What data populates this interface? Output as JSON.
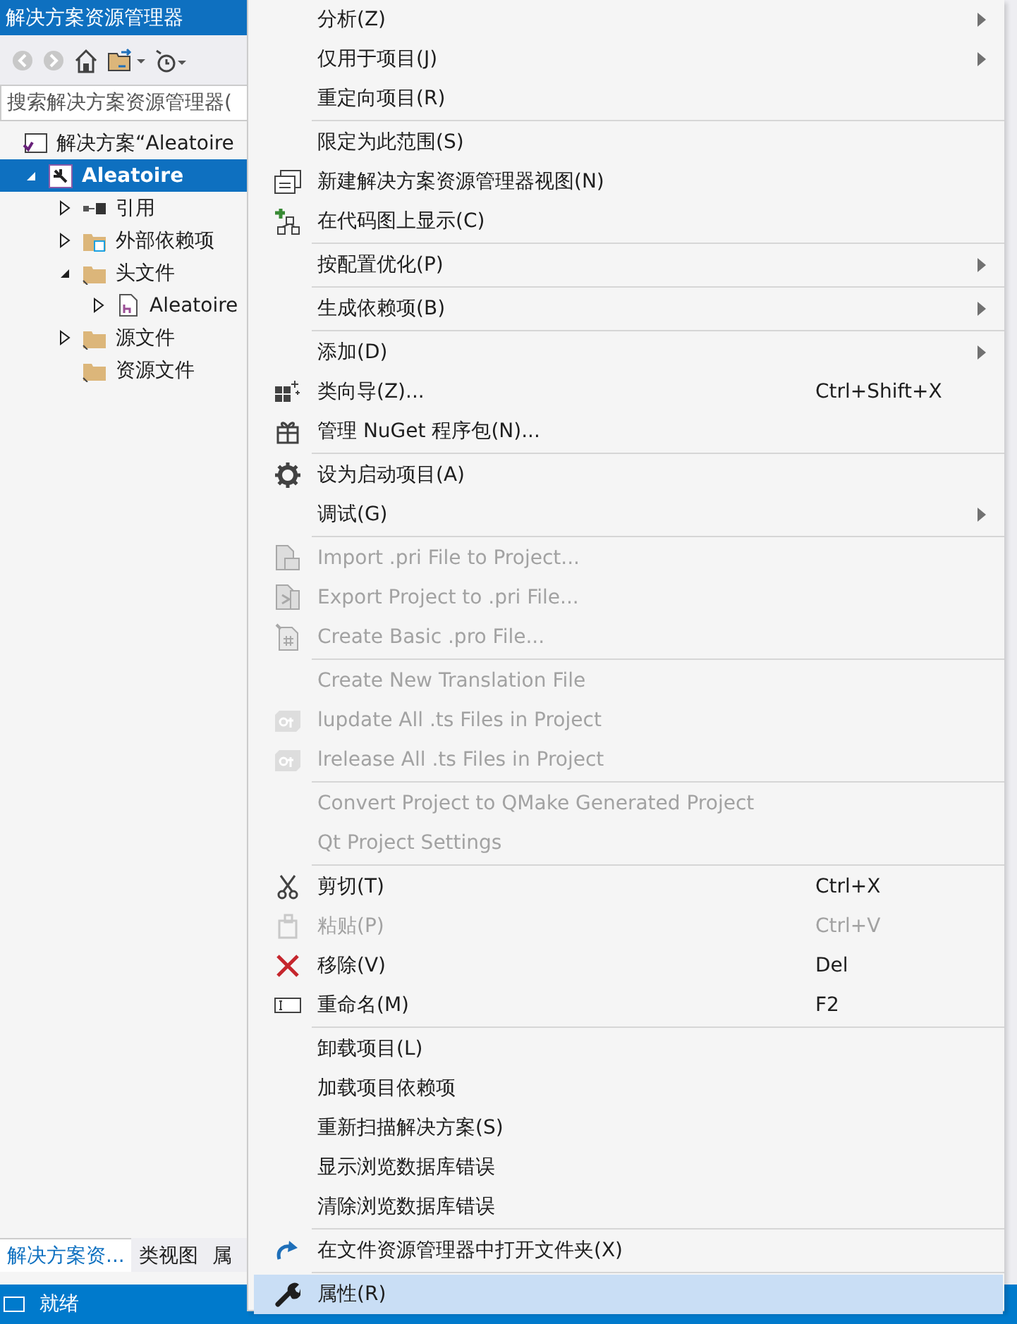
{
  "panel": {
    "title": "解决方案资源管理器",
    "search": {
      "placeholder": "搜索解决方案资源管理器("
    },
    "tree": [
      {
        "label": "解决方案“Aleatoire",
        "selected": false,
        "children": [
          {
            "label": "Aleatoire",
            "expanded": true,
            "selected": true,
            "children": [
              {
                "label": "引用",
                "expanded": false,
                "selected": false
              },
              {
                "label": "外部依赖项",
                "expanded": false,
                "selected": false
              },
              {
                "label": "头文件",
                "expanded": true,
                "selected": false,
                "children": [
                  {
                    "label": "Aleatoire",
                    "expanded": false,
                    "selected": false
                  }
                ]
              },
              {
                "label": "源文件",
                "expanded": false,
                "selected": false
              },
              {
                "label": "资源文件",
                "selected": false
              }
            ]
          }
        ]
      }
    ],
    "tabs": [
      {
        "label": "解决方案资...",
        "selected": true
      },
      {
        "label": "类视图",
        "selected": false
      },
      {
        "label": "属",
        "selected": false
      }
    ]
  },
  "status_bar": {
    "text": "就绪"
  },
  "menu": {
    "groups": [
      {
        "items": [
          {
            "label": "分析(Z)",
            "submenu": true,
            "disabled": false,
            "selected": false
          },
          {
            "label": "仅用于项目(J)",
            "submenu": true,
            "disabled": false,
            "selected": false
          },
          {
            "label": "重定向项目(R)",
            "submenu": false,
            "disabled": false,
            "selected": false
          }
        ]
      },
      {
        "items": [
          {
            "label": "限定为此范围(S)",
            "submenu": false,
            "disabled": false,
            "selected": false
          },
          {
            "label": "新建解决方案资源管理器视图(N)",
            "submenu": false,
            "disabled": false,
            "selected": false
          },
          {
            "label": "在代码图上显示(C)",
            "submenu": false,
            "disabled": false,
            "selected": false
          }
        ]
      },
      {
        "items": [
          {
            "label": "按配置优化(P)",
            "submenu": true,
            "disabled": false,
            "selected": false
          }
        ]
      },
      {
        "items": [
          {
            "label": "生成依赖项(B)",
            "submenu": true,
            "disabled": false,
            "selected": false
          }
        ]
      },
      {
        "items": [
          {
            "label": "添加(D)",
            "submenu": true,
            "disabled": false,
            "selected": false
          },
          {
            "label": "类向导(Z)...",
            "shortcut": "Ctrl+Shift+X",
            "submenu": false,
            "disabled": false,
            "selected": false
          },
          {
            "label": "管理 NuGet 程序包(N)...",
            "submenu": false,
            "disabled": false,
            "selected": false
          }
        ]
      },
      {
        "items": [
          {
            "label": "设为启动项目(A)",
            "submenu": false,
            "disabled": false,
            "selected": false
          },
          {
            "label": "调试(G)",
            "submenu": true,
            "disabled": false,
            "selected": false
          }
        ]
      },
      {
        "items": [
          {
            "label": "Import .pri File to Project...",
            "submenu": false,
            "disabled": true,
            "selected": false
          },
          {
            "label": "Export Project to .pri File...",
            "submenu": false,
            "disabled": true,
            "selected": false
          },
          {
            "label": "Create Basic .pro File...",
            "submenu": false,
            "disabled": true,
            "selected": false
          }
        ]
      },
      {
        "items": [
          {
            "label": "Create New Translation File",
            "submenu": false,
            "disabled": true,
            "selected": false
          },
          {
            "label": "lupdate All .ts Files in Project",
            "submenu": false,
            "disabled": true,
            "selected": false
          },
          {
            "label": "lrelease All .ts Files in Project",
            "submenu": false,
            "disabled": true,
            "selected": false
          }
        ]
      },
      {
        "items": [
          {
            "label": "Convert Project to QMake Generated Project",
            "submenu": false,
            "disabled": true,
            "selected": false
          },
          {
            "label": "Qt Project Settings",
            "submenu": false,
            "disabled": true,
            "selected": false
          }
        ]
      },
      {
        "items": [
          {
            "label": "剪切(T)",
            "shortcut": "Ctrl+X",
            "submenu": false,
            "disabled": false,
            "selected": false
          },
          {
            "label": "粘贴(P)",
            "shortcut": "Ctrl+V",
            "submenu": false,
            "disabled": true,
            "selected": false
          },
          {
            "label": "移除(V)",
            "shortcut": "Del",
            "submenu": false,
            "disabled": false,
            "selected": false
          },
          {
            "label": "重命名(M)",
            "shortcut": "F2",
            "submenu": false,
            "disabled": false,
            "selected": false
          }
        ]
      },
      {
        "items": [
          {
            "label": "卸载项目(L)",
            "submenu": false,
            "disabled": false,
            "selected": false
          },
          {
            "label": "加载项目依赖项",
            "submenu": false,
            "disabled": false,
            "selected": false
          },
          {
            "label": "重新扫描解决方案(S)",
            "submenu": false,
            "disabled": false,
            "selected": false
          },
          {
            "label": "显示浏览数据库错误",
            "submenu": false,
            "disabled": false,
            "selected": false
          },
          {
            "label": "清除浏览数据库错误",
            "submenu": false,
            "disabled": false,
            "selected": false
          }
        ]
      },
      {
        "items": [
          {
            "label": "在文件资源管理器中打开文件夹(X)",
            "submenu": false,
            "disabled": false,
            "selected": false
          }
        ]
      },
      {
        "items": [
          {
            "label": "属性(R)",
            "submenu": false,
            "disabled": false,
            "selected": true
          }
        ]
      }
    ]
  }
}
